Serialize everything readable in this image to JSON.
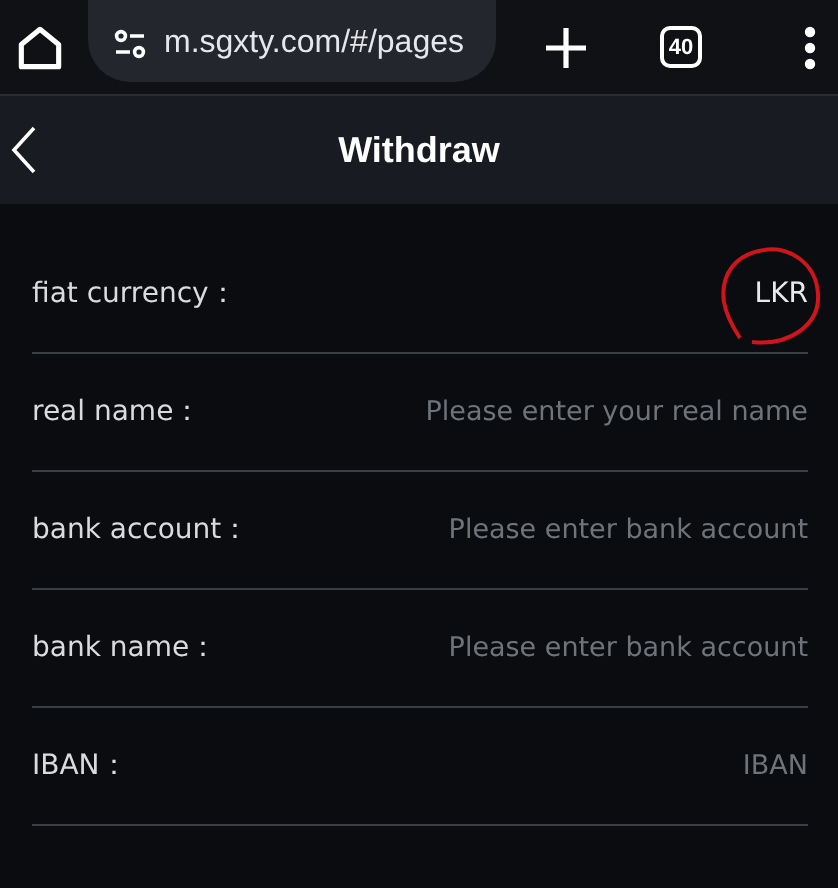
{
  "browser": {
    "url": "m.sgxty.com/#/pages",
    "tab_count": "40"
  },
  "header": {
    "title": "Withdraw"
  },
  "fields": [
    {
      "label": "fiat currency：",
      "value": "LKR",
      "circled": true
    },
    {
      "label": "real name：",
      "placeholder": "Please enter your real name",
      "circled": false
    },
    {
      "label": "bank account：",
      "placeholder": "Please enter bank account",
      "circled": false
    },
    {
      "label": "bank name：",
      "placeholder": "Please enter bank account",
      "circled": false
    },
    {
      "label": "IBAN：",
      "placeholder": "IBAN",
      "circled": false
    }
  ]
}
